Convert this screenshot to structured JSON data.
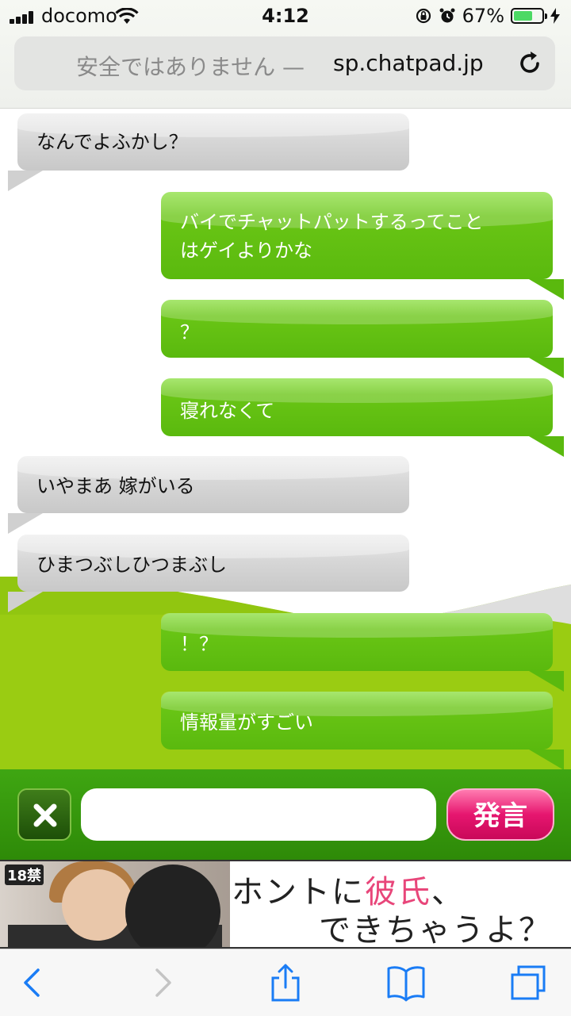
{
  "status_bar": {
    "carrier": "docomo",
    "time": "4:12",
    "battery_percent_label": "67%",
    "battery_level": 0.67
  },
  "url_bar": {
    "insecure_label": "安全ではありません —",
    "host": "sp.chatpad.jp",
    "icons": [
      "reload-icon"
    ]
  },
  "messages": [
    {
      "side": "in",
      "text": "なんでよふかし？"
    },
    {
      "side": "out",
      "text": "バイでチャットパットするってこと\nはゲイよりかな"
    },
    {
      "side": "out",
      "text": "？"
    },
    {
      "side": "out",
      "text": "寝れなくて"
    },
    {
      "side": "in",
      "text": "いやまあ 嫁がいる"
    },
    {
      "side": "in",
      "text": "ひまつぶしひつまぶし"
    },
    {
      "side": "out",
      "text": "！？"
    },
    {
      "side": "out",
      "text": "情報量がすごい"
    }
  ],
  "input_bar": {
    "value": "",
    "placeholder": "",
    "send_label": "発言",
    "clear_icon": "close-icon"
  },
  "ad": {
    "age_badge": "18禁",
    "line1_pre": "ホントに",
    "line1_pink": "彼氏",
    "line1_post": "、",
    "line2": "できちゃうよ？"
  },
  "toolbar": {
    "icons": [
      "back-icon",
      "forward-icon",
      "share-icon",
      "bookmarks-icon",
      "tabs-icon"
    ]
  },
  "colors": {
    "accent_green": "#5ab90e",
    "send_pink": "#e6166f",
    "battery_green": "#4cd964"
  }
}
